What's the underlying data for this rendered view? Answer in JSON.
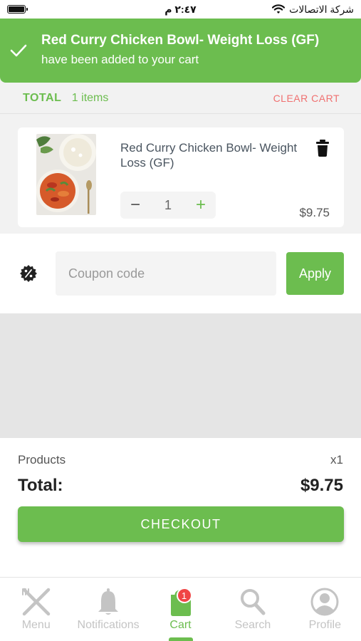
{
  "status_bar": {
    "time": "٢:٤٧ م",
    "carrier": "شركة الاتصالات"
  },
  "toast": {
    "title": "Red Curry Chicken Bowl- Weight Loss (GF)",
    "subtitle": "have been added to your cart",
    "icon": "check-icon"
  },
  "cart_header": {
    "total_label": "TOTAL",
    "items_count": "1 items",
    "clear_label": "CLEAR CART"
  },
  "cart_items": [
    {
      "name": "Red Curry Chicken Bowl- Weight Loss (GF)",
      "quantity": "1",
      "price": "$9.75",
      "minus_symbol": "−",
      "plus_symbol": "+"
    }
  ],
  "coupon": {
    "placeholder": "Coupon code",
    "apply_label": "Apply"
  },
  "summary": {
    "products_label": "Products",
    "products_count": "x1",
    "total_label": "Total:",
    "total_value": "$9.75",
    "checkout_label": "CHECKOUT"
  },
  "tab_bar": {
    "tabs": [
      {
        "label": "Menu",
        "icon": "utensils-icon"
      },
      {
        "label": "Notifications",
        "icon": "bell-icon"
      },
      {
        "label": "Cart",
        "icon": "shopping-bag-icon",
        "badge": "1"
      },
      {
        "label": "Search",
        "icon": "search-icon"
      },
      {
        "label": "Profile",
        "icon": "user-icon"
      }
    ],
    "active_index": 2
  },
  "colors": {
    "accent": "#6cbd4f",
    "danger": "#f07070",
    "badge": "#f04545"
  }
}
